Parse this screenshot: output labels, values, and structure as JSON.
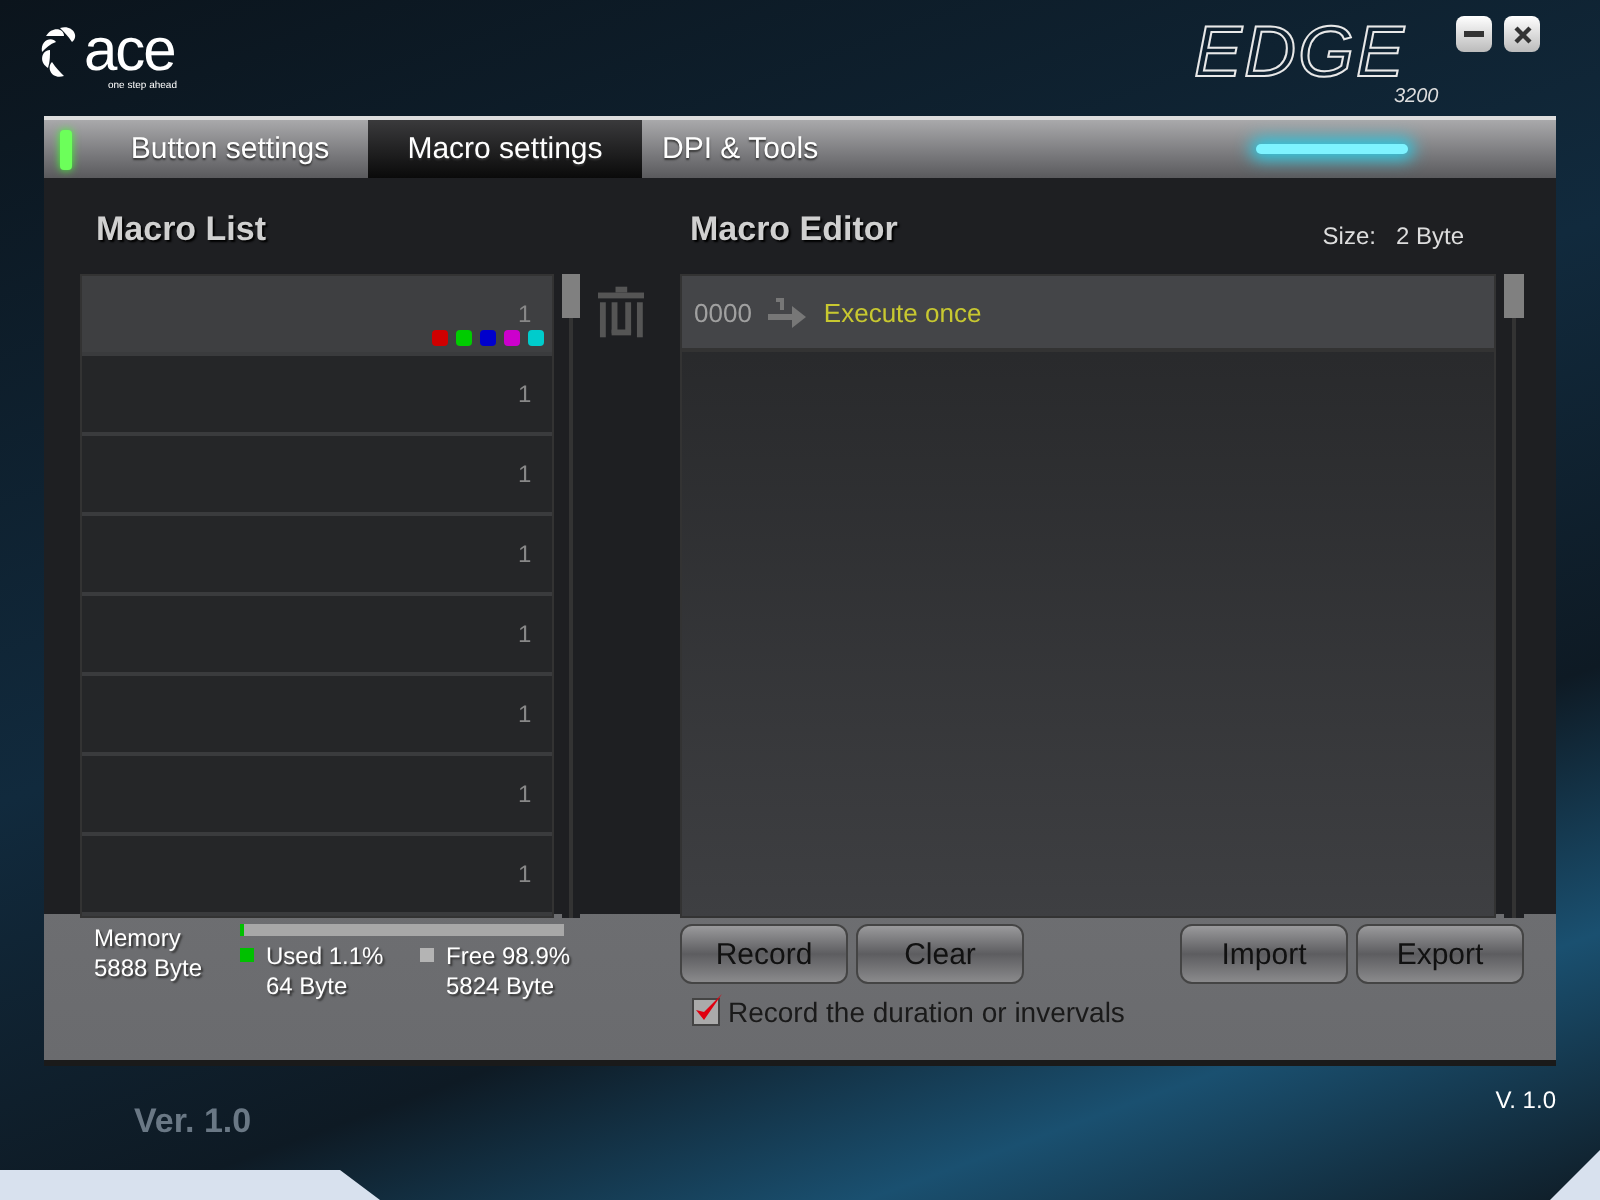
{
  "header": {
    "logo": "ace",
    "tagline": "one step ahead",
    "product": "EDGE",
    "model": "3200"
  },
  "tabs": [
    {
      "label": "Button settings",
      "selected": false
    },
    {
      "label": "Macro settings",
      "selected": true
    },
    {
      "label": "DPI & Tools",
      "selected": false
    }
  ],
  "macro_list": {
    "title": "Macro List",
    "items": [
      {
        "count": "1",
        "selected": true,
        "dots": [
          {
            "color": "#d00000"
          },
          {
            "color": "#00cc00"
          },
          {
            "color": "#0000cc"
          },
          {
            "color": "#cc00cc"
          },
          {
            "color": "#00cccc"
          }
        ]
      },
      {
        "count": "1",
        "selected": false
      },
      {
        "count": "1",
        "selected": false
      },
      {
        "count": "1",
        "selected": false
      },
      {
        "count": "1",
        "selected": false
      },
      {
        "count": "1",
        "selected": false
      },
      {
        "count": "1",
        "selected": false
      },
      {
        "count": "1",
        "selected": false
      }
    ]
  },
  "macro_editor": {
    "title": "Macro Editor",
    "size_label": "Size:",
    "size_value": "2 Byte",
    "steps": [
      {
        "index": "0000",
        "action": "Execute once",
        "selected": true
      }
    ]
  },
  "memory": {
    "label": "Memory",
    "total": "5888 Byte",
    "level": 0.011,
    "legend": [
      {
        "label": "Used 1.1%",
        "amount": "64 Byte",
        "color": "#00c000"
      },
      {
        "label": "Free 98.9%",
        "amount": "5824 Byte",
        "color": "#b4b4b4"
      }
    ]
  },
  "buttons": {
    "left": [
      "Record",
      "Clear"
    ],
    "right": [
      "Import",
      "Export"
    ]
  },
  "record_timing": {
    "label": "Record the duration or invervals",
    "checked": true
  },
  "footer": {
    "faint_version": "Ver.  1.0",
    "version": "V. 1.0"
  }
}
